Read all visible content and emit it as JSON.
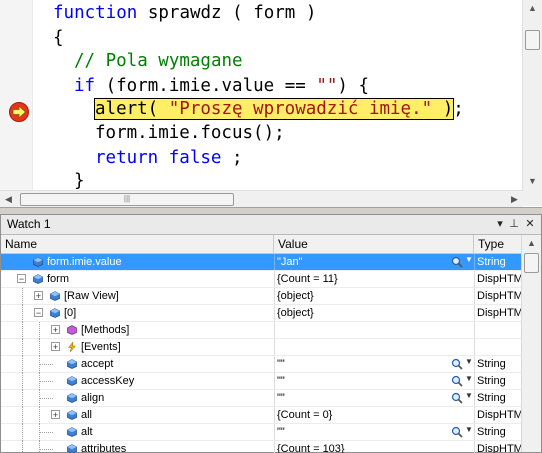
{
  "editor": {
    "lines": [
      {
        "kw": "function",
        "rest": " sprawdz ( form )"
      },
      {
        "text": "{"
      },
      {
        "comment": "// Pola wymagane"
      },
      {
        "kw": "if",
        "pre": " (form.imie.value == ",
        "str": "\"\"",
        "post": ") {"
      },
      {
        "call": "alert( ",
        "str": "\"Proszę wprowadzić imię.\"",
        "close": " )",
        "tail": ";"
      },
      {
        "text": "form.imie.focus();"
      },
      {
        "kw": "return",
        "kw2": " false",
        "rest": " ;"
      },
      {
        "text": "}"
      }
    ]
  },
  "watch": {
    "title": "Watch 1",
    "title_buttons": {
      "dropdown": "▾",
      "pin": "⊥",
      "close": "✕"
    },
    "columns": {
      "name": "Name",
      "value": "Value",
      "type": "Type"
    },
    "rows": [
      {
        "name": "form.imie.value",
        "value": "\"Jan\"",
        "type": "String",
        "selected": true,
        "inspect": true
      },
      {
        "name": "form",
        "value": "{Count = 11}",
        "type": "DispHTML",
        "expander": "-"
      },
      {
        "name": "[Raw View]",
        "value": "{object}",
        "type": "DispHTML",
        "expander": "+"
      },
      {
        "name": "[0]",
        "value": "{object}",
        "type": "DispHTML",
        "expander": "-"
      },
      {
        "name": "[Methods]",
        "value": "",
        "type": "",
        "expander": "+"
      },
      {
        "name": "[Events]",
        "value": "",
        "type": "",
        "expander": "+"
      },
      {
        "name": "accept",
        "value": "\"\"",
        "type": "String",
        "inspect": true
      },
      {
        "name": "accessKey",
        "value": "\"\"",
        "type": "String",
        "inspect": true
      },
      {
        "name": "align",
        "value": "\"\"",
        "type": "String",
        "inspect": true
      },
      {
        "name": "all",
        "value": "{Count = 0}",
        "type": "DispHTML",
        "expander": "+"
      },
      {
        "name": "alt",
        "value": "\"\"",
        "type": "String",
        "inspect": true
      },
      {
        "name": "attributes",
        "value": "{Count = 103}",
        "type": "DispHTML"
      }
    ]
  },
  "colors": {
    "keyword": "#0000ff",
    "comment": "#008000",
    "string": "#a31515",
    "highlight": "#ffee66",
    "selection": "#3399ff"
  }
}
